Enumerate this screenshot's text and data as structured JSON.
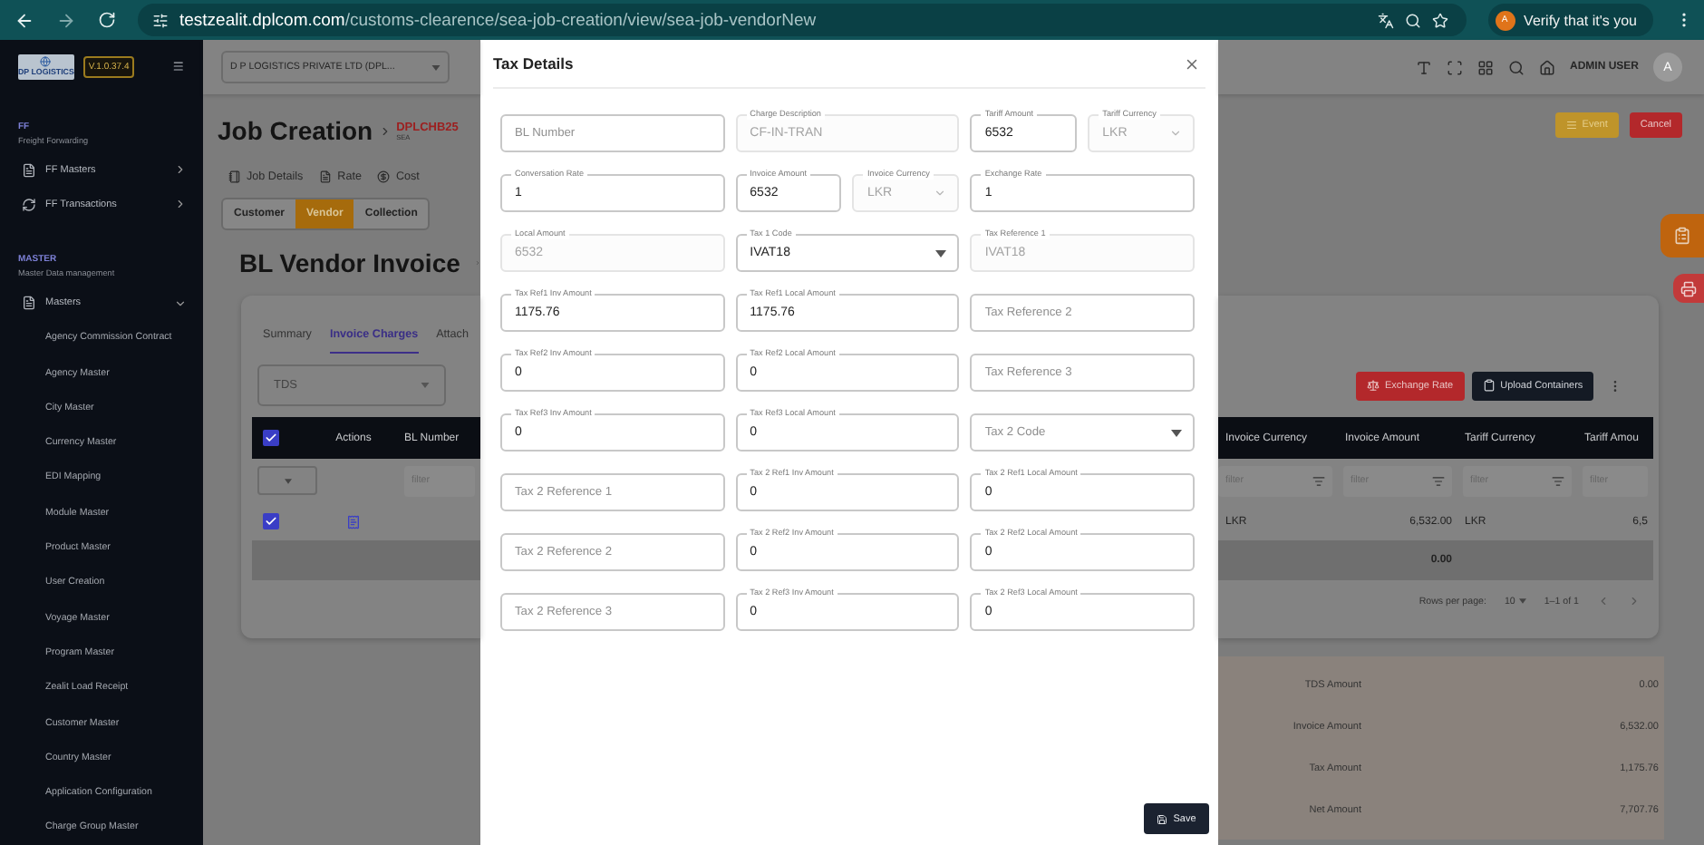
{
  "browser": {
    "domain": "testzealit.dplcom.com",
    "path": "/customs-clearence/sea-job-creation/view/sea-job-vendorNew",
    "profile_avatar": "A",
    "profile_label": "Verify that it's you"
  },
  "sidebar": {
    "logo": "DP LOGISTICS",
    "version": "V.1.0.37.4",
    "sections": [
      {
        "title": "FF",
        "subtitle": "Freight Forwarding",
        "items": [
          {
            "label": "FF Masters",
            "kind": "document",
            "expanded": false
          },
          {
            "label": "FF Transactions",
            "kind": "sync",
            "expanded": false
          }
        ]
      },
      {
        "title": "MASTER",
        "subtitle": "Master Data management",
        "items": [
          {
            "label": "Masters",
            "kind": "document",
            "expanded": true,
            "children": [
              {
                "label": "Agency Commission Contract"
              },
              {
                "label": "Agency Master"
              },
              {
                "label": "City Master"
              },
              {
                "label": "Currency Master"
              },
              {
                "label": "EDI Mapping"
              },
              {
                "label": "Module Master"
              },
              {
                "label": "Product Master"
              },
              {
                "label": "User Creation"
              },
              {
                "label": "Voyage Master"
              },
              {
                "label": "Program Master"
              },
              {
                "label": "Zealit Load Receipt"
              },
              {
                "label": "Customer Master"
              },
              {
                "label": "Country Master"
              },
              {
                "label": "Application Configuration"
              },
              {
                "label": "Charge Group Master"
              }
            ]
          }
        ]
      }
    ]
  },
  "header": {
    "company": "D P LOGISTICS PRIVATE LTD  (DPL...",
    "user": "ADMIN USER",
    "avatar": "A"
  },
  "job": {
    "title": "Job Creation",
    "number": "DPLCHB25",
    "mode": "SEA",
    "tabs": [
      {
        "label": "Job Details",
        "kind": "details"
      },
      {
        "label": "Rate",
        "kind": "rate"
      },
      {
        "label": "Cost",
        "kind": "cost"
      }
    ],
    "party_tabs": [
      {
        "label": "Customer",
        "selected": false
      },
      {
        "label": "Vendor",
        "selected": true
      },
      {
        "label": "Collection",
        "selected": false
      }
    ]
  },
  "actions": [
    {
      "label": "Event",
      "kind": "warning"
    },
    {
      "label": "Cancel",
      "kind": "danger"
    }
  ],
  "invoice": {
    "title": "BL Vendor Invoice",
    "tabs": [
      {
        "label": "Summary",
        "selected": false
      },
      {
        "label": "Invoice Charges",
        "selected": true
      },
      {
        "label": "Attach",
        "selected": false
      }
    ],
    "tax_type": "TDS",
    "buttons": [
      {
        "label": "Exchange Rate",
        "kind": "danger"
      },
      {
        "label": "Upload Containers",
        "kind": "dark"
      }
    ],
    "table": {
      "header_checked": true,
      "left_columns": [
        "Actions",
        "BL Number"
      ],
      "right_columns": [
        {
          "label": "Invoice Currency",
          "numeric": false
        },
        {
          "label": "Invoice Amount",
          "numeric": true
        },
        {
          "label": "Tariff Currency",
          "numeric": false
        },
        {
          "label": "Tariff Amou",
          "numeric": true
        }
      ],
      "left_filter": "filter",
      "right_filters": [
        "filter",
        "filter",
        "filter",
        "filter"
      ],
      "rows": [
        {
          "checked": true,
          "cells": [
            "LKR",
            "6,532.00",
            "LKR",
            "6,5"
          ]
        }
      ],
      "total": "0.00",
      "rows_per_page_label": "Rows per page:",
      "rows_per_page": "10",
      "range": "1–1 of 1"
    }
  },
  "summary": [
    {
      "label": "TDS Amount",
      "value": "0.00"
    },
    {
      "label": "Invoice Amount",
      "value": "6,532.00"
    },
    {
      "label": "Tax Amount",
      "value": "1,175.76"
    },
    {
      "label": "Net Amount",
      "value": "7,707.76"
    }
  ],
  "modal": {
    "title": "Tax Details",
    "save": "Save",
    "rows": [
      {
        "fields": [
          {
            "kind": "text",
            "placeholder": "BL Number",
            "disabled": false,
            "narrow": false
          },
          {
            "kind": "text",
            "label": "Charge Description",
            "value": "CF-IN-TRAN",
            "disabled": true,
            "narrow": false
          },
          {
            "kind": "text",
            "label": "Tariff Amount",
            "value": "6532",
            "disabled": false,
            "narrow": true
          },
          {
            "kind": "select",
            "label": "Tariff Currency",
            "value": "LKR",
            "disabled": true,
            "narrow": true
          }
        ]
      },
      {
        "fields": [
          {
            "kind": "text",
            "label": "Conversation Rate",
            "value": "1",
            "disabled": false,
            "narrow": false
          },
          {
            "kind": "text",
            "label": "Invoice Amount",
            "value": "6532",
            "disabled": false,
            "narrow": true
          },
          {
            "kind": "select",
            "label": "Invoice Currency",
            "value": "LKR",
            "disabled": true,
            "narrow": true
          },
          {
            "kind": "text",
            "label": "Exchange Rate",
            "value": "1",
            "disabled": false,
            "narrow": false
          }
        ]
      },
      {
        "fields": [
          {
            "kind": "text",
            "label": "Local Amount",
            "value": "6532",
            "disabled": true,
            "narrow": false
          },
          {
            "kind": "select",
            "label": "Tax 1 Code",
            "value": "IVAT18",
            "disabled": false,
            "narrow": false
          },
          {
            "kind": "text",
            "label": "Tax Reference 1",
            "value": "IVAT18",
            "disabled": true,
            "narrow": false
          }
        ]
      },
      {
        "fields": [
          {
            "kind": "text",
            "label": "Tax Ref1 Inv Amount",
            "value": "1175.76",
            "disabled": false,
            "narrow": false
          },
          {
            "kind": "text",
            "label": "Tax Ref1 Local Amount",
            "value": "1175.76",
            "disabled": false,
            "narrow": false
          },
          {
            "kind": "text",
            "placeholder": "Tax Reference 2",
            "disabled": false,
            "narrow": false
          }
        ]
      },
      {
        "fields": [
          {
            "kind": "text",
            "label": "Tax Ref2 Inv Amount",
            "value": "0",
            "disabled": false,
            "narrow": false
          },
          {
            "kind": "text",
            "label": "Tax Ref2 Local Amount",
            "value": "0",
            "disabled": false,
            "narrow": false
          },
          {
            "kind": "text",
            "placeholder": "Tax Reference 3",
            "disabled": false,
            "narrow": false
          }
        ]
      },
      {
        "fields": [
          {
            "kind": "text",
            "label": "Tax Ref3 Inv Amount",
            "value": "0",
            "disabled": false,
            "narrow": false
          },
          {
            "kind": "text",
            "label": "Tax Ref3 Local Amount",
            "value": "0",
            "disabled": false,
            "narrow": false
          },
          {
            "kind": "select",
            "placeholder": "Tax 2 Code",
            "disabled": false,
            "narrow": false
          }
        ]
      },
      {
        "fields": [
          {
            "kind": "text",
            "placeholder": "Tax 2 Reference 1",
            "disabled": false,
            "narrow": false
          },
          {
            "kind": "text",
            "label": "Tax 2 Ref1 Inv Amount",
            "value": "0",
            "disabled": false,
            "narrow": false
          },
          {
            "kind": "text",
            "label": "Tax 2 Ref1 Local Amount",
            "value": "0",
            "disabled": false,
            "narrow": false
          }
        ]
      },
      {
        "fields": [
          {
            "kind": "text",
            "placeholder": "Tax 2 Reference 2",
            "disabled": false,
            "narrow": false
          },
          {
            "kind": "text",
            "label": "Tax 2 Ref2 Inv Amount",
            "value": "0",
            "disabled": false,
            "narrow": false
          },
          {
            "kind": "text",
            "label": "Tax 2 Ref2 Local Amount",
            "value": "0",
            "disabled": false,
            "narrow": false
          }
        ]
      },
      {
        "fields": [
          {
            "kind": "text",
            "placeholder": "Tax 2 Reference 3",
            "disabled": false,
            "narrow": false
          },
          {
            "kind": "text",
            "label": "Tax 2 Ref3 Inv Amount",
            "value": "0",
            "disabled": false,
            "narrow": false
          },
          {
            "kind": "text",
            "label": "Tax 2 Ref3 Local Amount",
            "value": "0",
            "disabled": false,
            "narrow": false
          }
        ]
      }
    ]
  }
}
